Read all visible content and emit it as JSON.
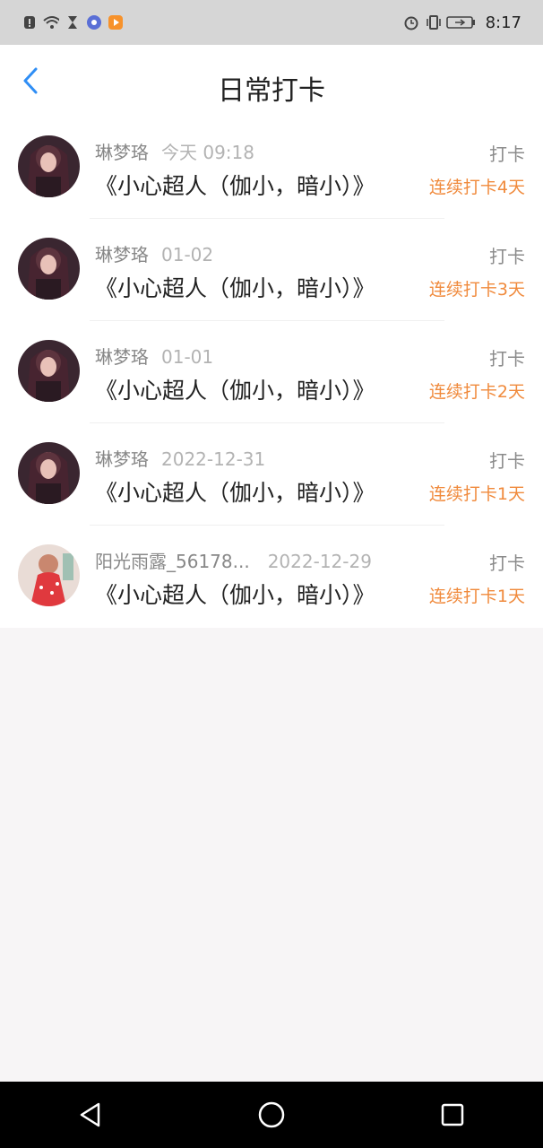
{
  "status_bar": {
    "time": "8:17",
    "left_icons": [
      "alert-icon",
      "wifi-icon",
      "hourglass-icon",
      "music-app-icon",
      "video-app-icon"
    ],
    "right_icons": [
      "alarm-icon",
      "vibrate-icon",
      "battery-icon"
    ]
  },
  "nav": {
    "title": "日常打卡"
  },
  "checkins": [
    {
      "user": "琳梦珞",
      "date": "今天 09:18",
      "book": "《小心超人（伽小，暗小）》",
      "action": "打卡",
      "streak": "连续打卡4天",
      "avatar": "anime-avatar"
    },
    {
      "user": "琳梦珞",
      "date": "01-02",
      "book": "《小心超人（伽小，暗小）》",
      "action": "打卡",
      "streak": "连续打卡3天",
      "avatar": "anime-avatar"
    },
    {
      "user": "琳梦珞",
      "date": "01-01",
      "book": "《小心超人（伽小，暗小）》",
      "action": "打卡",
      "streak": "连续打卡2天",
      "avatar": "anime-avatar"
    },
    {
      "user": "琳梦珞",
      "date": "2022-12-31",
      "book": "《小心超人（伽小，暗小）》",
      "action": "打卡",
      "streak": "连续打卡1天",
      "avatar": "anime-avatar"
    },
    {
      "user": "阳光雨露_56178...",
      "date": "2022-12-29",
      "book": "《小心超人（伽小，暗小）》",
      "action": "打卡",
      "streak": "连续打卡1天",
      "avatar": "photo-avatar"
    }
  ],
  "colors": {
    "accent": "#2f8ef5",
    "streak": "#f08a3c",
    "status_bar_bg": "#d6d6d6",
    "page_bg": "#f7f5f6"
  }
}
